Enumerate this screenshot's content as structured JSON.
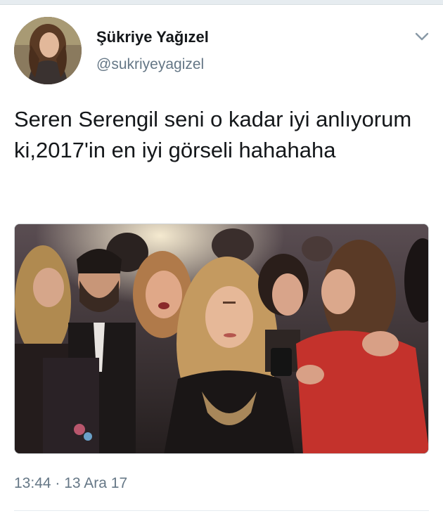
{
  "user": {
    "display_name": "Şükriye Yağızel",
    "handle": "@sukriyeyagizel",
    "avatar_icon": "profile-photo"
  },
  "tweet": {
    "text": "Seren Serengil seni o kadar iyi anlıyorum ki,2017'in en iyi görseli hahahaha",
    "timestamp": "13:44 · 13 Ara 17"
  },
  "icons": {
    "menu": "chevron-down-icon"
  },
  "colors": {
    "primary_text": "#14171a",
    "secondary_text": "#657786",
    "divider": "#e6ecf0",
    "red_dress": "#c4322c"
  }
}
